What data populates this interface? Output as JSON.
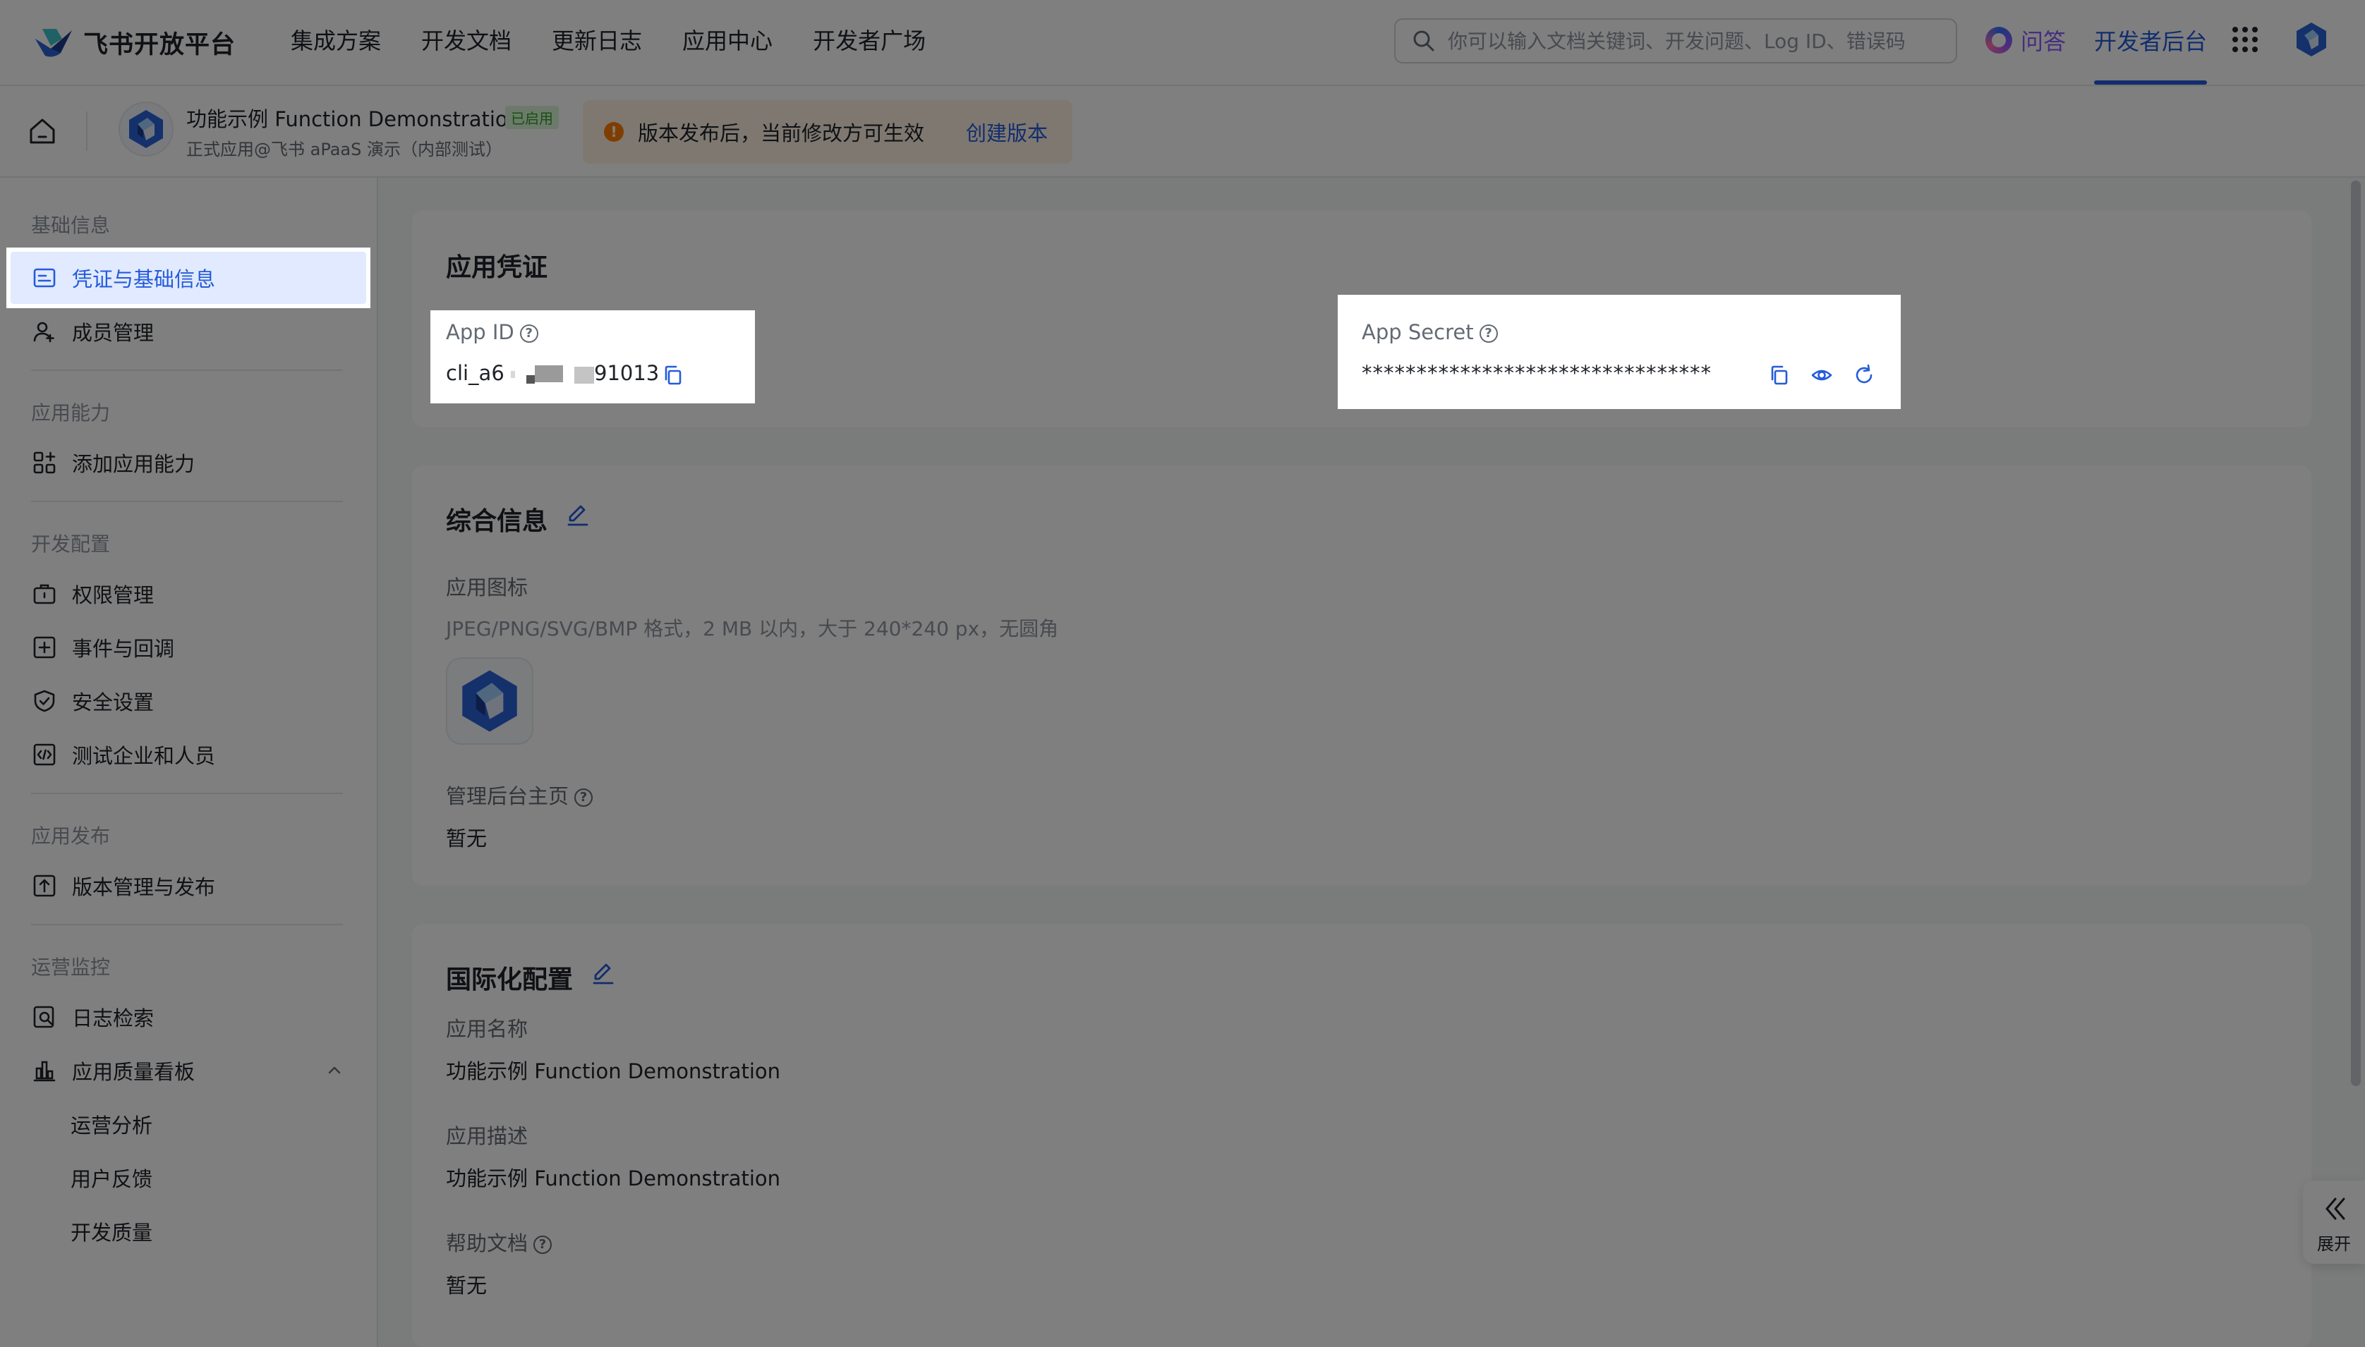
{
  "brand": {
    "name": "飞书开放平台"
  },
  "nav": {
    "items": [
      "集成方案",
      "开发文档",
      "更新日志",
      "应用中心",
      "开发者广场"
    ],
    "search_placeholder": "你可以输入文档关键词、开发问题、Log ID、错误码",
    "qa_label": "问答",
    "console_label": "开发者后台"
  },
  "app": {
    "name": "功能示例 Function Demonstration",
    "status_badge": "已启用",
    "subtitle": "正式应用@飞书 aPaaS 演示（内部测试）",
    "notice": "版本发布后，当前修改方可生效",
    "notice_link": "创建版本"
  },
  "sidebar": {
    "sections": [
      {
        "title": "基础信息",
        "items": [
          "凭证与基础信息",
          "成员管理"
        ]
      },
      {
        "title": "应用能力",
        "items": [
          "添加应用能力"
        ]
      },
      {
        "title": "开发配置",
        "items": [
          "权限管理",
          "事件与回调",
          "安全设置",
          "测试企业和人员"
        ]
      },
      {
        "title": "应用发布",
        "items": [
          "版本管理与发布"
        ]
      },
      {
        "title": "运营监控",
        "items": [
          "日志检索",
          "应用质量看板"
        ],
        "subitems": [
          "运营分析",
          "用户反馈",
          "开发质量"
        ]
      }
    ],
    "active_item": "凭证与基础信息"
  },
  "credentials": {
    "title": "应用凭证",
    "app_id_label": "App ID",
    "app_id_prefix": "cli_a6",
    "app_id_suffix": "91013",
    "app_secret_label": "App Secret",
    "app_secret_value": "********************************"
  },
  "general": {
    "title": "综合信息",
    "icon_label": "应用图标",
    "icon_hint": "JPEG/PNG/SVG/BMP 格式，2 MB 以内，大于 240*240 px，无圆角",
    "admin_home_label": "管理后台主页",
    "admin_home_value": "暂无"
  },
  "i18n": {
    "title": "国际化配置",
    "name_label": "应用名称",
    "name_value": "功能示例 Function Demonstration",
    "desc_label": "应用描述",
    "desc_value": "功能示例 Function Demonstration",
    "help_label": "帮助文档",
    "help_value": "暂无"
  },
  "expand": {
    "label": "展开"
  },
  "colors": {
    "accent": "#245bdb",
    "active_bg": "#e1eaff",
    "notice_bg": "#fdf0e3",
    "warning": "#ff7d00",
    "enabled_green": "#2ea121"
  }
}
